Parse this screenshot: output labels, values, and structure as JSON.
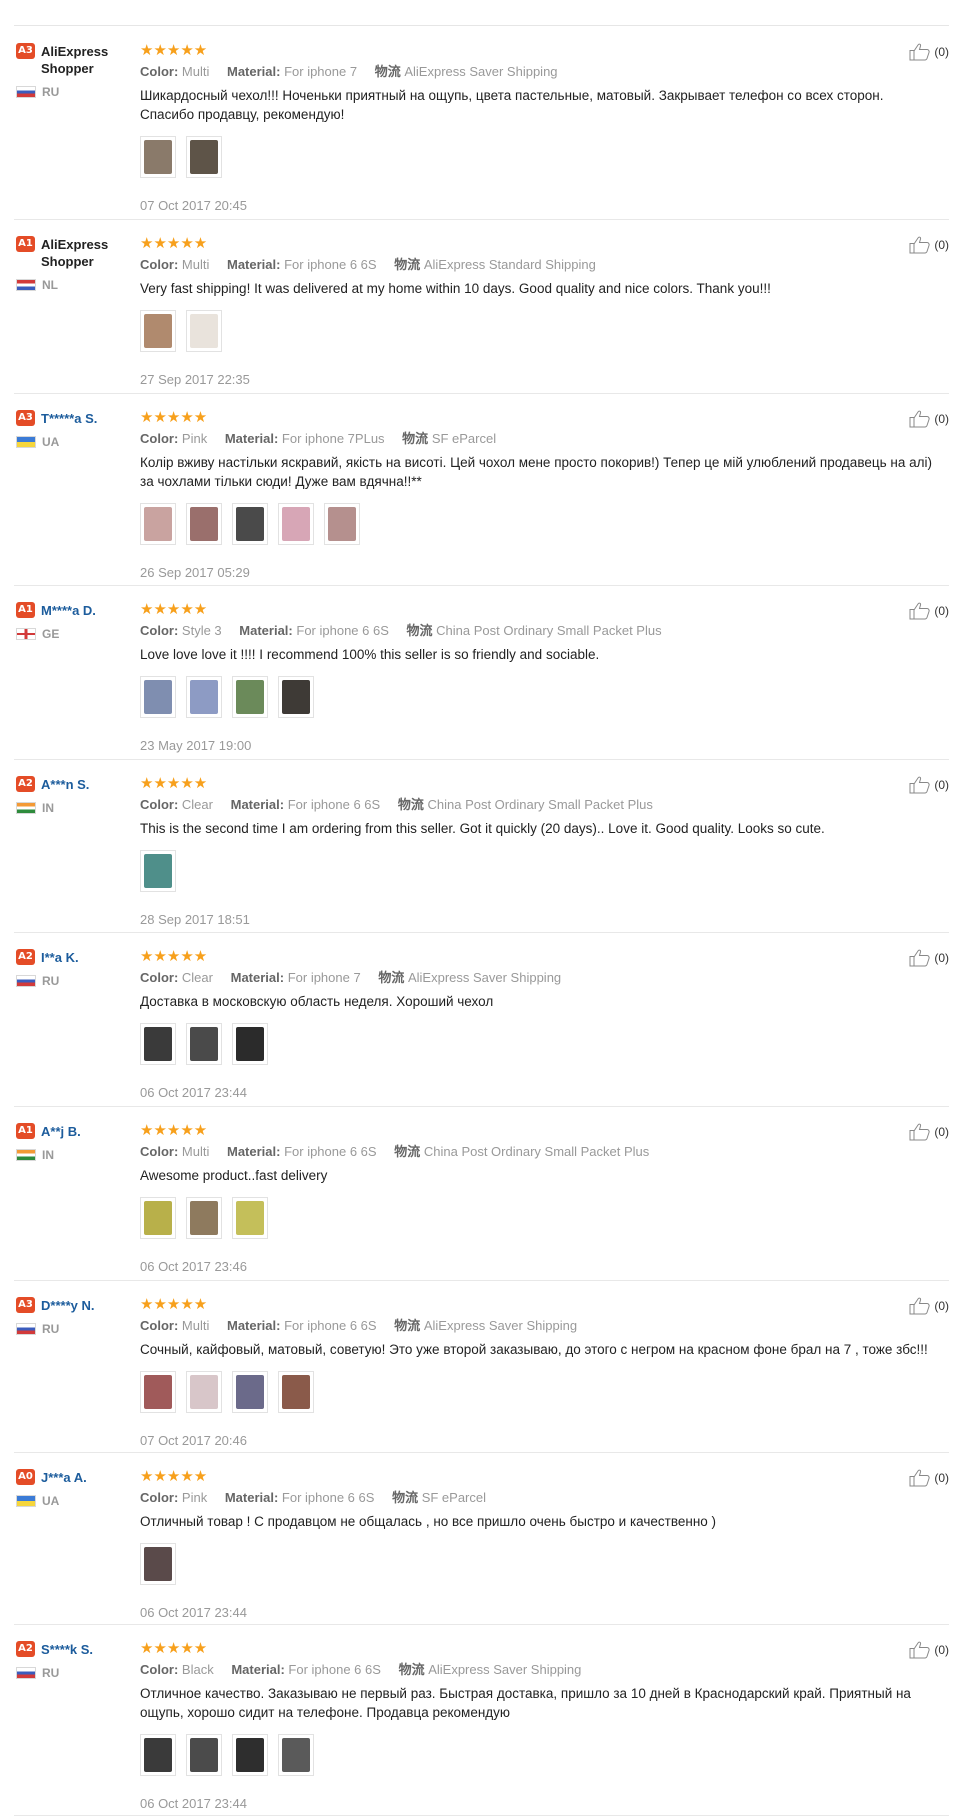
{
  "labels": {
    "color": "Color:",
    "material": "Material:",
    "shipping_prefix": "物流"
  },
  "reviews": [
    {
      "level": "A3",
      "user": "AliExpress Shopper",
      "shopper": true,
      "country": "RU",
      "stars": "★★★★★",
      "color": "Multi",
      "material": "For iphone 7",
      "shipping": "AliExpress Saver Shipping",
      "text": "Шикардосный чехол!!! Ноченьки приятный на ощупь, цвета пастельные, матовый. Закрывает телефон со всех сторон. Спасибо продавцу, рекомендую!",
      "thumbs": [
        "#8a7a6a",
        "#5e5448"
      ],
      "date": "07 Oct 2017 20:45",
      "likes": "(0)"
    },
    {
      "level": "A1",
      "user": "AliExpress Shopper",
      "shopper": true,
      "country": "NL",
      "stars": "★★★★★",
      "color": "Multi",
      "material": "For iphone 6 6S",
      "shipping": "AliExpress Standard Shipping",
      "text": "Very fast shipping! It was delivered at my home within 10 days. Good quality and nice colors. Thank you!!!",
      "thumbs": [
        "#b08a6e",
        "#e9e3dc"
      ],
      "date": "27 Sep 2017 22:35",
      "likes": "(0)"
    },
    {
      "level": "A3",
      "user": "T*****a S.",
      "shopper": false,
      "country": "UA",
      "stars": "★★★★★",
      "color": "Pink",
      "material": "For iphone 7PLus",
      "shipping": "SF eParcel",
      "text": "Колір вживу настільки яскравий, якість на висоті. Цей чохол мене просто покорив!) Тепер це мій улюблений продавець на алі) за чохлами тільки сюди! Дуже вам вдячна!!**",
      "thumbs": [
        "#c9a3a0",
        "#9a6f6c",
        "#4a4a4a",
        "#d7a6b6",
        "#b5908e"
      ],
      "date": "26 Sep 2017 05:29",
      "likes": "(0)"
    },
    {
      "level": "A1",
      "user": "M****a D.",
      "shopper": false,
      "country": "GE",
      "stars": "★★★★★",
      "color": "Style 3",
      "material": "For iphone 6 6S",
      "shipping": "China Post Ordinary Small Packet Plus",
      "text": "Love love love it !!!! I recommend 100% this seller is so friendly and sociable.",
      "thumbs": [
        "#7f8eb0",
        "#8d9bc4",
        "#6b8a5a",
        "#3e3a36"
      ],
      "date": "23 May 2017 19:00",
      "likes": "(0)"
    },
    {
      "level": "A2",
      "user": "A***n S.",
      "shopper": false,
      "country": "IN",
      "stars": "★★★★★",
      "color": "Clear",
      "material": "For iphone 6 6S",
      "shipping": "China Post Ordinary Small Packet Plus",
      "text": "This is the second time I am ordering from this seller. Got it quickly (20 days).. Love it. Good quality. Looks so cute.",
      "thumbs": [
        "#4f8f8a"
      ],
      "date": "28 Sep 2017 18:51",
      "likes": "(0)"
    },
    {
      "level": "A2",
      "user": "I**a K.",
      "shopper": false,
      "country": "RU",
      "stars": "★★★★★",
      "color": "Clear",
      "material": "For iphone 7",
      "shipping": "AliExpress Saver Shipping",
      "text": "Доставка в московскую область неделя. Хороший чехол",
      "thumbs": [
        "#3a3a3a",
        "#4a4a4a",
        "#2b2b2b"
      ],
      "date": "06 Oct 2017 23:44",
      "likes": "(0)"
    },
    {
      "level": "A1",
      "user": "A**j B.",
      "shopper": false,
      "country": "IN",
      "stars": "★★★★★",
      "color": "Multi",
      "material": "For iphone 6 6S",
      "shipping": "China Post Ordinary Small Packet Plus",
      "text": "Awesome product..fast delivery",
      "thumbs": [
        "#b8b04a",
        "#8e7a5e",
        "#c4bf5a"
      ],
      "date": "06 Oct 2017 23:46",
      "likes": "(0)"
    },
    {
      "level": "A3",
      "user": "D****y N.",
      "shopper": false,
      "country": "RU",
      "stars": "★★★★★",
      "color": "Multi",
      "material": "For iphone 6 6S",
      "shipping": "AliExpress Saver Shipping",
      "text": "Сочный, кайфовый, матовый, советую! Это уже второй заказываю, до этого с негром на красном фоне брал на 7 , тоже збс!!!",
      "thumbs": [
        "#a05a5a",
        "#d8c6c9",
        "#6b6a8a",
        "#8a5a4a"
      ],
      "date": "07 Oct 2017 20:46",
      "likes": "(0)"
    },
    {
      "level": "A0",
      "user": "J***a A.",
      "shopper": false,
      "country": "UA",
      "stars": "★★★★★",
      "color": "Pink",
      "material": "For iphone 6 6S",
      "shipping": "SF eParcel",
      "text": "Отличный товар ! С продавцом не общалась , но все пришло очень быстро и качественно )",
      "thumbs": [
        "#5a4a4a"
      ],
      "date": "06 Oct 2017 23:44",
      "likes": "(0)"
    },
    {
      "level": "A2",
      "user": "S****k S.",
      "shopper": false,
      "country": "RU",
      "stars": "★★★★★",
      "color": "Black",
      "material": "For iphone 6 6S",
      "shipping": "AliExpress Saver Shipping",
      "text": "Отличное качество. Заказываю не первый раз. Быстрая доставка, пришло за 10 дней в Краснодарский край. Приятный на ощупь, хорошо сидит на телефоне. Продавца рекомендую",
      "thumbs": [
        "#3a3a3a",
        "#4b4b4b",
        "#2e2e2e",
        "#5a5a5a"
      ],
      "date": "06 Oct 2017 23:44",
      "likes": "(0)"
    }
  ]
}
